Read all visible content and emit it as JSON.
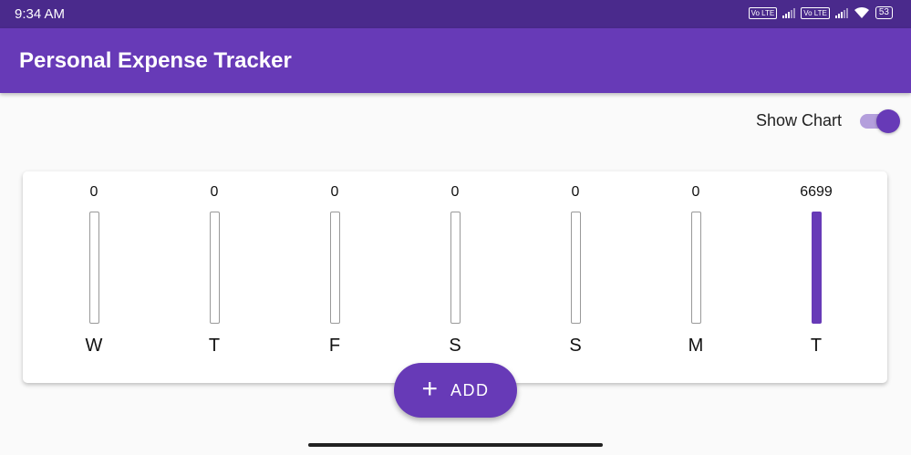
{
  "status_bar": {
    "time": "9:34 AM",
    "volte1": "Vo LTE",
    "volte2": "Vo LTE",
    "battery": "53",
    "icons": [
      "volte-icon",
      "signal-icon",
      "volte-icon",
      "signal-icon",
      "wifi-icon",
      "battery-icon"
    ]
  },
  "app_bar": {
    "title": "Personal Expense Tracker"
  },
  "toggle": {
    "label": "Show Chart",
    "checked": true
  },
  "chart_data": {
    "type": "bar",
    "categories": [
      "W",
      "T",
      "F",
      "S",
      "S",
      "M",
      "T"
    ],
    "values": [
      0,
      0,
      0,
      0,
      0,
      0,
      6699
    ],
    "labels": [
      "0",
      "0",
      "0",
      "0",
      "0",
      "0",
      "6699"
    ],
    "title": "",
    "xlabel": "",
    "ylabel": "",
    "ylim": [
      0,
      6699
    ],
    "grid": false,
    "bar_color": "#673ab7"
  },
  "fab": {
    "label": "ADD",
    "icon": "plus-icon"
  },
  "colors": {
    "primary": "#673ab7",
    "status_bar": "#4a2a8c",
    "track": "#b49fdc"
  }
}
